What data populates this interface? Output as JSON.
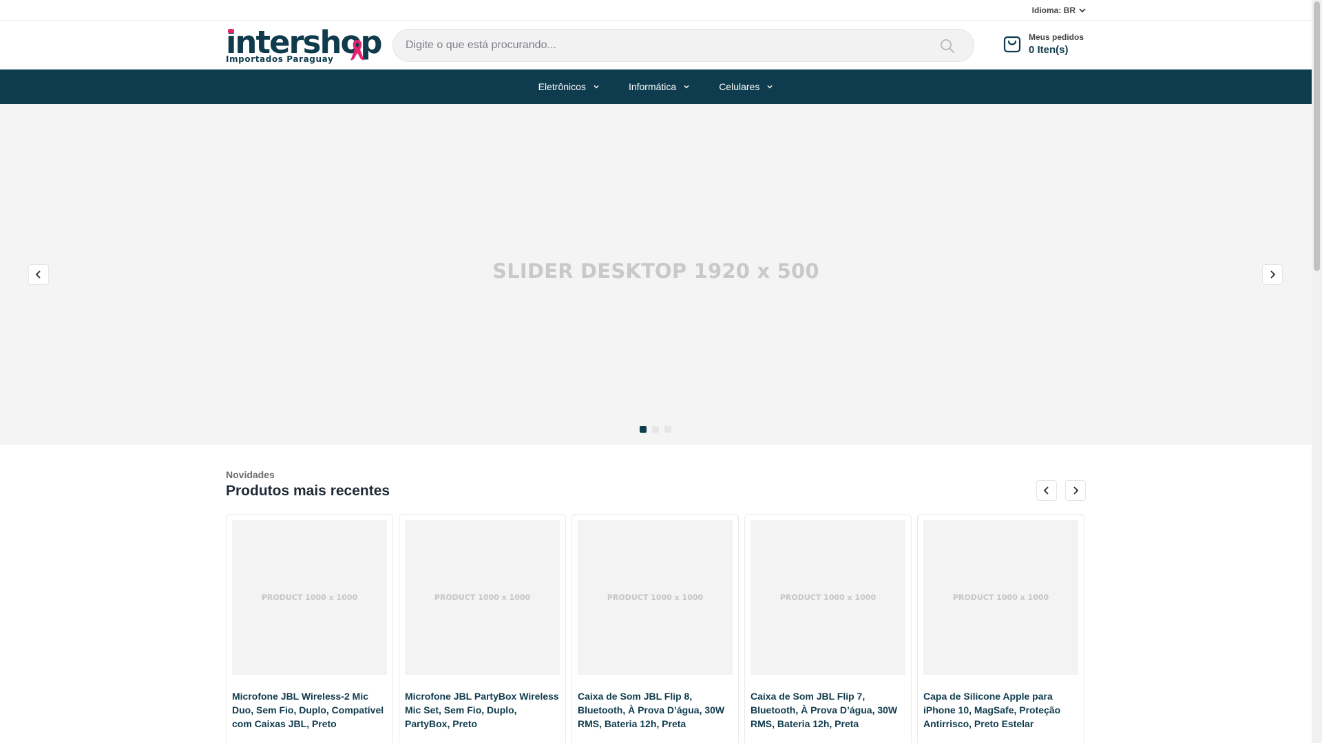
{
  "topbar": {
    "language_label": "Idioma: BR"
  },
  "header": {
    "logo_brand": "intershop",
    "logo_tagline": "Importados Paraguay",
    "search_placeholder": "Digite o que está procurando...",
    "orders_label": "Meus pedidos",
    "orders_count": "0 Iten(s)"
  },
  "nav": {
    "items": [
      {
        "label": "Eletrônicos"
      },
      {
        "label": "Informática"
      },
      {
        "label": "Celulares"
      }
    ]
  },
  "hero": {
    "placeholder_text": "SLIDER DESKTOP 1920 x 500",
    "slide_count": 3,
    "active_slide": 1
  },
  "section": {
    "kicker": "Novidades",
    "title": "Produtos mais recentes"
  },
  "products": [
    {
      "image_text": "PRODUCT 1000 x 1000",
      "name": "Microfone JBL Wireless-2 Mic Duo, Sem Fio, Duplo, Compatível com Caixas JBL, Preto"
    },
    {
      "image_text": "PRODUCT 1000 x 1000",
      "name": "Microfone JBL PartyBox Wireless Mic Set, Sem Fio, Duplo, PartyBox, Preto"
    },
    {
      "image_text": "PRODUCT 1000 x 1000",
      "name": "Caixa de Som JBL Flip 8, Bluetooth, À Prova D’água, 30W RMS, Bateria 12h, Preta"
    },
    {
      "image_text": "PRODUCT 1000 x 1000",
      "name": "Caixa de Som JBL Flip 7, Bluetooth, À Prova D’água, 30W RMS, Bateria 12h, Preta"
    },
    {
      "image_text": "PRODUCT 1000 x 1000",
      "name": "Capa de Silicone Apple para iPhone 10, MagSafe, Proteção Antirrisco, Preto Estelar"
    }
  ],
  "colors": {
    "brand_dark": "#0e3b4d",
    "accent_pink": "#e4246f",
    "hero_bg": "#f4f4f4"
  },
  "icons": {
    "language": "chevron-down-icon",
    "search": "search-icon",
    "orders": "shopping-bag-icon",
    "nav": "chevron-down-icon",
    "slider_prev": "chevron-left-icon",
    "slider_next": "chevron-right-icon"
  }
}
